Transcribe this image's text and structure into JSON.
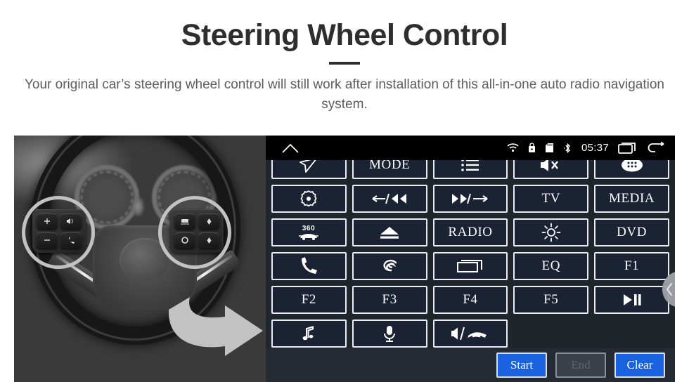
{
  "header": {
    "title": "Steering Wheel Control",
    "subtitle": "Your original car’s steering wheel control will still work after installation of this all-in-one auto radio navigation system."
  },
  "photo": {
    "name": "steering-wheel-photo",
    "highlight_color": "#f2c513",
    "arrow_color": "#f2c513",
    "left_pod_keys": [
      "+",
      "−",
      "voice-icon",
      "phone-icon"
    ],
    "right_pod_keys": [
      "display-icon",
      "up-arrow-icon",
      "circle-icon",
      "down-arrow-icon"
    ]
  },
  "headunit": {
    "statusbar": {
      "home_icon": "home-icon",
      "icons": [
        "wifi-icon",
        "usb-lock-icon",
        "sd-card-icon",
        "bluetooth-icon"
      ],
      "time": "05:37",
      "recents_icon": "recents-icon",
      "back_icon": "back-icon"
    },
    "colors": {
      "button_fill": "#1b2234",
      "button_border": "#e9ecf2",
      "panel_bg": "#20242b",
      "bottom_bg": "#262b33",
      "accent": "#1a62e0"
    },
    "grid": [
      [
        {
          "label": "",
          "icon": "navigation-arrow-icon"
        },
        {
          "label": "MODE",
          "icon": ""
        },
        {
          "label": "",
          "icon": "list-icon"
        },
        {
          "label": "",
          "icon": "mute-icon"
        },
        {
          "label": "",
          "icon": "apps-grid-icon"
        }
      ],
      [
        {
          "label": "",
          "icon": "settings-target-icon"
        },
        {
          "label": "",
          "icon": "prev-track-icon"
        },
        {
          "label": "",
          "icon": "next-track-icon"
        },
        {
          "label": "TV",
          "icon": ""
        },
        {
          "label": "MEDIA",
          "icon": ""
        }
      ],
      [
        {
          "label": "",
          "icon": "car-360-icon"
        },
        {
          "label": "",
          "icon": "eject-icon"
        },
        {
          "label": "RADIO",
          "icon": ""
        },
        {
          "label": "",
          "icon": "brightness-icon"
        },
        {
          "label": "DVD",
          "icon": ""
        }
      ],
      [
        {
          "label": "",
          "icon": "phone-icon"
        },
        {
          "label": "",
          "icon": "swirl-voice-icon"
        },
        {
          "label": "",
          "icon": "screen-window-icon"
        },
        {
          "label": "EQ",
          "icon": ""
        },
        {
          "label": "F1",
          "icon": ""
        }
      ],
      [
        {
          "label": "F2",
          "icon": ""
        },
        {
          "label": "F3",
          "icon": ""
        },
        {
          "label": "F4",
          "icon": ""
        },
        {
          "label": "F5",
          "icon": ""
        },
        {
          "label": "",
          "icon": "play-pause-icon"
        }
      ],
      [
        {
          "label": "",
          "icon": "music-note-icon"
        },
        {
          "label": "",
          "icon": "microphone-icon"
        },
        {
          "label": "",
          "icon": "volume-hangup-icon"
        },
        {
          "label": "",
          "icon": ""
        },
        {
          "label": "",
          "icon": ""
        }
      ]
    ],
    "drawer_handle_icon": "chevron-left-icon",
    "actions": [
      {
        "label": "Start",
        "state": "enabled"
      },
      {
        "label": "End",
        "state": "disabled"
      },
      {
        "label": "Clear",
        "state": "enabled"
      }
    ]
  }
}
